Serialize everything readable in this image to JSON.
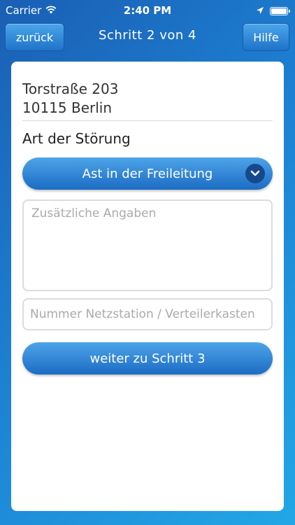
{
  "status_bar": {
    "carrier": "Carrier",
    "time": "2:40 PM",
    "icons": [
      "wifi-icon",
      "location-arrow-icon",
      "battery-icon"
    ]
  },
  "nav": {
    "back_label": "zurück",
    "title": "Schritt 2 von 4",
    "help_label": "Hilfe"
  },
  "address": {
    "street": "Torstraße 203",
    "city": "10115 Berlin"
  },
  "disturbance": {
    "label": "Art der Störung",
    "selected": "Ast in der Freileitung"
  },
  "form": {
    "details_placeholder": "Zusätzliche Angaben",
    "station_placeholder": "Nummer Netzstation / Verteilerkasten",
    "next_label": "weiter zu Schritt 3"
  },
  "colors": {
    "background_start": "#1a5fb4",
    "background_end": "#22a7e6",
    "button_top": "#4da4e8",
    "button_bottom": "#1c6cc4",
    "chevron_bg": "#17488c"
  }
}
